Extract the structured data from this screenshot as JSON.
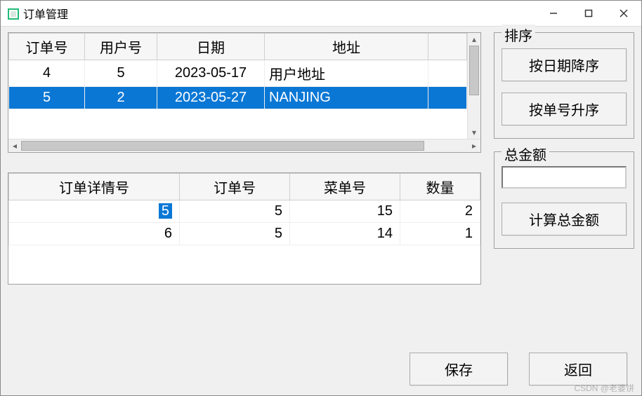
{
  "window": {
    "title": "订单管理",
    "controls": {
      "min": "—",
      "max": "☐",
      "close": "✕"
    }
  },
  "orderTable": {
    "headers": [
      "订单号",
      "用户号",
      "日期",
      "地址"
    ],
    "rows": [
      {
        "cols": [
          "4",
          "5",
          "2023-05-17",
          "用户地址"
        ],
        "selected": false
      },
      {
        "cols": [
          "5",
          "2",
          "2023-05-27",
          "NANJING"
        ],
        "selected": true
      }
    ]
  },
  "detailTable": {
    "headers": [
      "订单详情号",
      "订单号",
      "菜单号",
      "数量"
    ],
    "rows": [
      {
        "cols": [
          "5",
          "5",
          "15",
          "2"
        ],
        "cellSelected": 0
      },
      {
        "cols": [
          "6",
          "5",
          "14",
          "1"
        ],
        "cellSelected": -1
      }
    ]
  },
  "sortGroup": {
    "title": "排序",
    "sortByDateDesc": "按日期降序",
    "sortByIdAsc": "按单号升序"
  },
  "totalGroup": {
    "title": "总金额",
    "value": "",
    "calcBtn": "计算总金额"
  },
  "bottom": {
    "save": "保存",
    "back": "返回"
  },
  "watermark": "CSDN @老婆饼"
}
